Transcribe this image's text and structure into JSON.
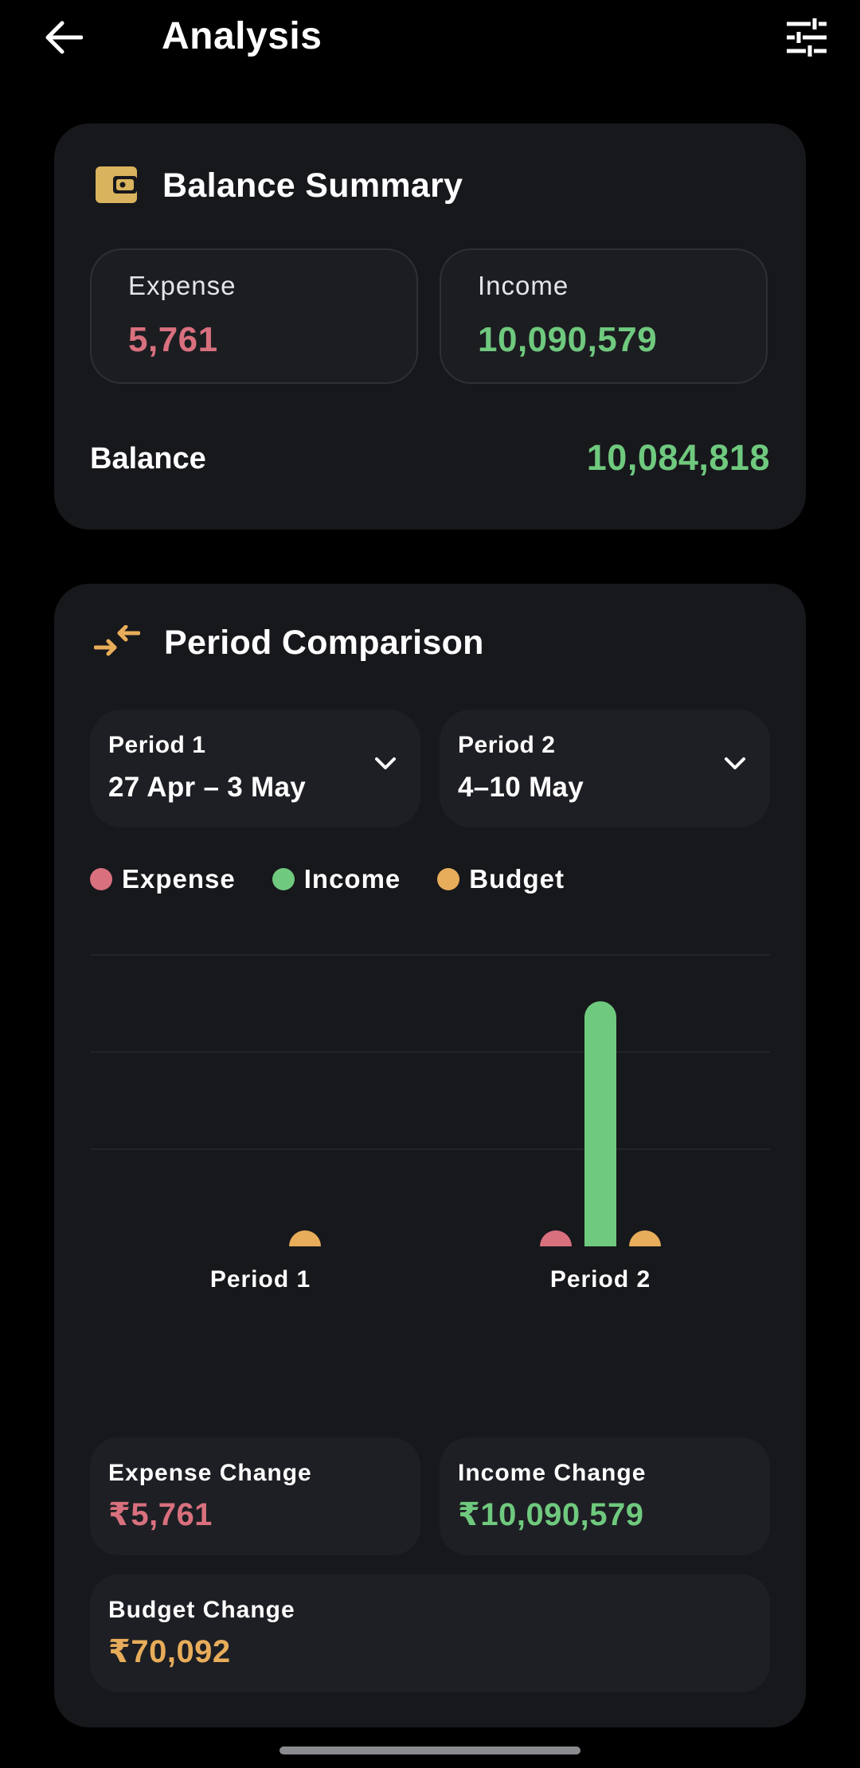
{
  "colors": {
    "expense": "#d9707e",
    "income": "#6fc97e",
    "budget": "#e8ad5a",
    "accent_icon": "#d9b35d"
  },
  "topbar": {
    "title": "Analysis",
    "back_icon": "arrow-left-icon",
    "filter_icon": "sliders-icon"
  },
  "balance_summary": {
    "title": "Balance Summary",
    "icon": "wallet-icon",
    "expense_label": "Expense",
    "expense_value": "5,761",
    "income_label": "Income",
    "income_value": "10,090,579",
    "balance_label": "Balance",
    "balance_value": "10,084,818"
  },
  "period_comparison": {
    "title": "Period Comparison",
    "icon": "compare-arrows-icon",
    "period1_label": "Period 1",
    "period1_range": "27 Apr – 3 May",
    "period2_label": "Period 2",
    "period2_range": "4–10 May",
    "dropdown_icon": "chevron-down-icon"
  },
  "chart_data": {
    "type": "bar",
    "categories": [
      "Period 1",
      "Period 2"
    ],
    "series": [
      {
        "name": "Expense",
        "values": [
          0,
          5761
        ]
      },
      {
        "name": "Income",
        "values": [
          0,
          10090579
        ]
      },
      {
        "name": "Budget",
        "values": [
          70092,
          70092
        ]
      }
    ],
    "ylim": [
      0,
      12000000
    ],
    "grid": true,
    "legend": "top-left"
  },
  "changes": {
    "expense_label": "Expense Change",
    "expense_value": "₹5,761",
    "income_label": "Income Change",
    "income_value": "₹10,090,579",
    "budget_label": "Budget Change",
    "budget_value": "₹70,092"
  }
}
